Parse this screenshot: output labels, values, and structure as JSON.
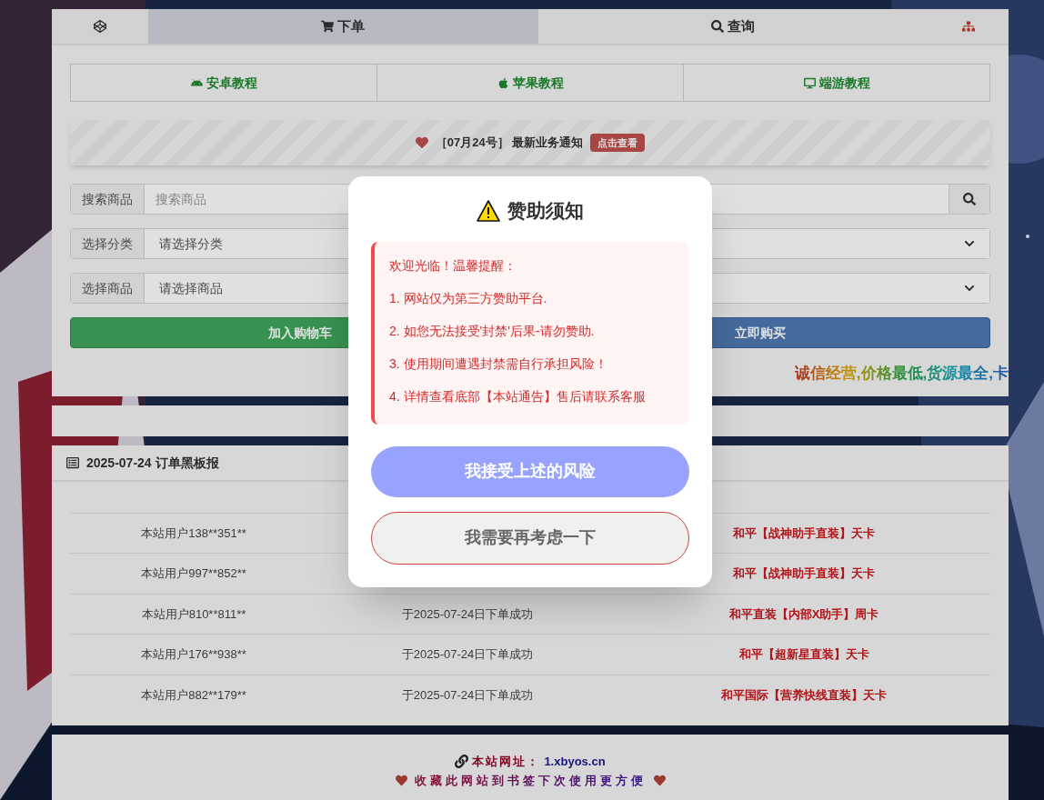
{
  "nav": {
    "tabs": [
      {
        "kind": "cube",
        "selected": false
      },
      {
        "kind": "cart",
        "label": "下单",
        "selected": true
      },
      {
        "kind": "search",
        "label": "查询",
        "selected": false
      },
      {
        "kind": "sitemap",
        "selected": false
      }
    ]
  },
  "tutorials": [
    {
      "kind": "android",
      "label": "安卓教程"
    },
    {
      "kind": "apple",
      "label": "苹果教程"
    },
    {
      "kind": "desktop",
      "label": "端游教程"
    }
  ],
  "notice": {
    "text": "［07月24号］ 最新业务通知",
    "badge": "点击查看"
  },
  "form": {
    "search": {
      "label": "搜索商品",
      "placeholder": "搜索商品"
    },
    "category": {
      "label": "选择分类",
      "value": "请选择分类"
    },
    "product": {
      "label": "选择商品",
      "value": "请选择商品"
    },
    "buttons": [
      {
        "kind": "cart",
        "label": "加入购物车"
      },
      {
        "kind": "buy",
        "label": "立即购买"
      }
    ]
  },
  "marquee": "诚信经营,价格最低,货源最全,卡",
  "orders": {
    "title": "2025-07-24 订单黑板报",
    "rows": [
      {
        "user": "本站用户138**351**",
        "item": "和平【战神助手直装】天卡"
      },
      {
        "user": "本站用户997**852**",
        "item": "和平【战神助手直装】天卡"
      },
      {
        "user": "本站用户810**811**",
        "status": "于2025-07-24日下单成功",
        "item": "和平直装【内部X助手】周卡"
      },
      {
        "user": "本站用户176**938**",
        "status": "于2025-07-24日下单成功",
        "item": "和平【超新星直装】天卡"
      },
      {
        "user": "本站用户882**179**",
        "status": "于2025-07-24日下单成功",
        "item": "和平国际【营养快线直装】天卡"
      }
    ]
  },
  "footer": {
    "site_label": "本站网址：",
    "site_url": "1.xbyos.cn",
    "bookmark": "收藏此网站到书签下次使用更方便"
  },
  "dialog": {
    "title": "赞助须知",
    "intro": "欢迎光临！温馨提醒：",
    "items": [
      "1. 网站仅为第三方赞助平台.",
      "2. 如您无法接受'封禁'后果-请勿赞助.",
      "3. 使用期间遭遇封禁需自行承担风险！",
      "4. 详情查看底部【本站通告】售后请联系客服"
    ],
    "buttons": [
      {
        "kind": "primary",
        "label": "我接受上述的风险"
      },
      {
        "kind": "secondary",
        "label": "我需要再考虑一下"
      }
    ]
  }
}
